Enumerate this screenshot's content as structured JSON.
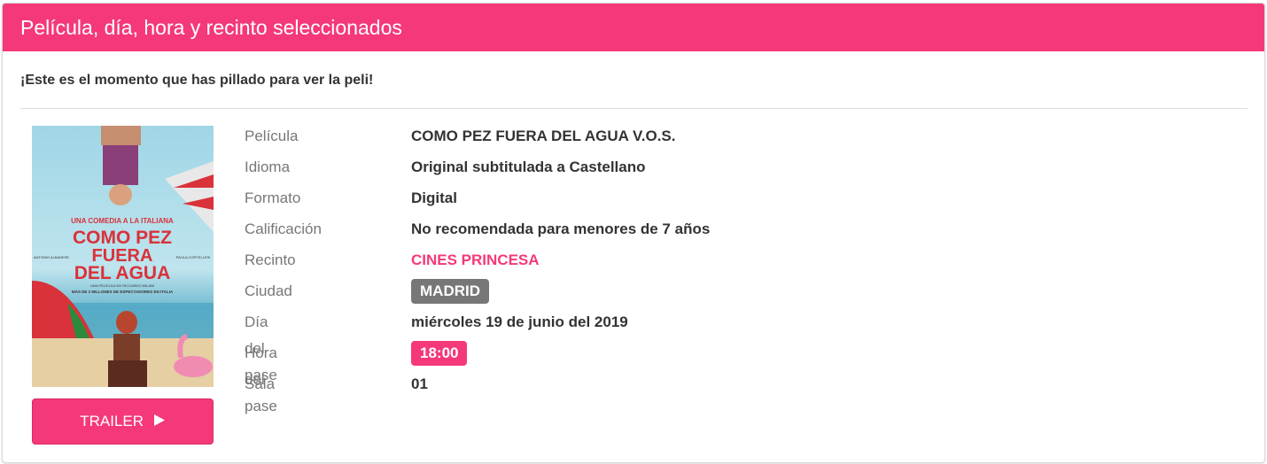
{
  "header": {
    "title": "Película, día, hora y recinto seleccionados"
  },
  "intro_text": "¡Este es el momento que has pillado para ver la peli!",
  "poster": {
    "top_line": "UNA COMEDIA A LA ITALIANA",
    "title_1": "COMO PEZ",
    "title_2": "FUERA",
    "title_3": "DEL AGUA",
    "director": "UNA PELÍCULA DE RICCARDO MILANI",
    "tagline": "MÁS DE 2 MILLONES DE ESPECTADORES EN ITALIA",
    "actor_left": "ANTONIO ALBANESE",
    "actor_right": "PAOLA CORTELLESI"
  },
  "trailer": {
    "label": "TRAILER",
    "icon": "play-icon"
  },
  "details": [
    {
      "label": "Película",
      "value": "COMO PEZ FUERA DEL AGUA V.O.S."
    },
    {
      "label": "Idioma",
      "value": "Original subtitulada a Castellano"
    },
    {
      "label": "Formato",
      "value": "Digital"
    },
    {
      "label": "Calificación",
      "value": "No recomendada para menores de 7 años"
    },
    {
      "label": "Recinto",
      "value": "CINES PRINCESA"
    },
    {
      "label": "Ciudad",
      "value": "MADRID"
    },
    {
      "label": "Día del pase",
      "value": "miércoles 19 de junio del 2019"
    },
    {
      "label": "Hora del pase",
      "value": "18:00"
    },
    {
      "label": "Sala",
      "value": "01"
    }
  ],
  "colors": {
    "accent": "#f5387a",
    "badge_gray": "#777777",
    "label_gray": "#777777"
  }
}
